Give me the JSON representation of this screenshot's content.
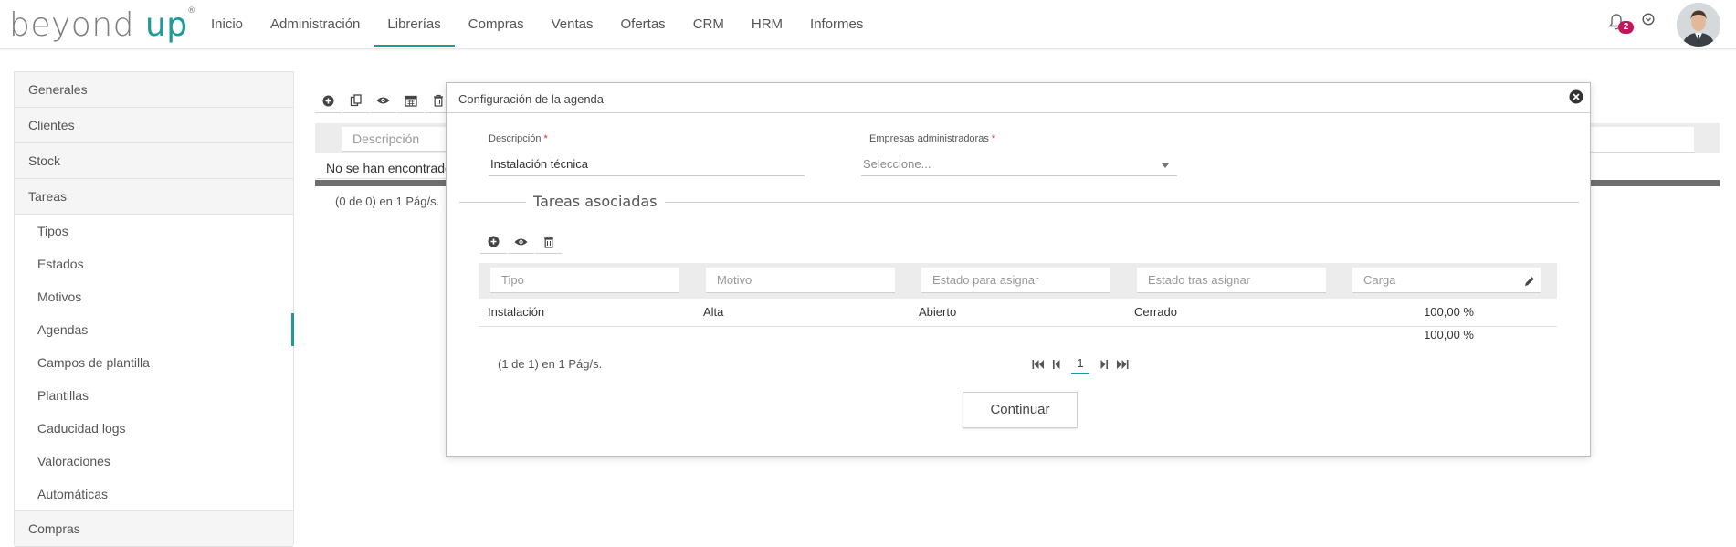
{
  "app": {
    "logo_part1": "beyond",
    "logo_part2": "up",
    "logo_reg": "®"
  },
  "nav": {
    "items": [
      "Inicio",
      "Administración",
      "Librerías",
      "Compras",
      "Ventas",
      "Ofertas",
      "CRM",
      "HRM",
      "Informes"
    ],
    "active_index": 2
  },
  "header_right": {
    "notifications_count": "2",
    "bell_icon": "bell-icon",
    "menu_icon": "chevron-circle-icon"
  },
  "sidebar": {
    "sections": [
      "Generales",
      "Clientes",
      "Stock",
      "Tareas"
    ],
    "subitems": [
      "Tipos",
      "Estados",
      "Motivos",
      "Agendas",
      "Campos de plantilla",
      "Plantillas",
      "Caducidad logs",
      "Valoraciones",
      "Automáticas"
    ],
    "active_subitem": "Agendas",
    "last_section": "Compras"
  },
  "background": {
    "toolbar_icons": [
      "plus-circle-icon",
      "copy-icon",
      "eye-icon",
      "calendar-icon",
      "trash-icon"
    ],
    "desc_placeholder": "Descripción",
    "no_rows": "No se han encontrado",
    "pagination": "(0 de 0) en 1 Pág/s."
  },
  "modal": {
    "title": "Configuración de la agenda",
    "descripcion_label": "Descripción",
    "descripcion_value": "Instalación técnica",
    "empresas_label": "Empresas administradoras",
    "empresas_placeholder": "Seleccione...",
    "required_mark": "*",
    "section_title": "Tareas asociadas",
    "toolbar_icons": [
      "plus-circle-icon",
      "eye-icon",
      "trash-icon"
    ],
    "grid": {
      "filters": [
        "Tipo",
        "Motivo",
        "Estado para asignar",
        "Estado tras asignar",
        "Carga"
      ],
      "rows": [
        {
          "tipo": "Instalación",
          "motivo": "Alta",
          "estado_para": "Abierto",
          "estado_tras": "Cerrado",
          "carga": "100,00 %"
        }
      ],
      "total": "100,00 %"
    },
    "pagination": {
      "text": "(1 de 1) en 1 Pág/s.",
      "current_page": "1"
    },
    "continue_label": "Continuar"
  },
  "colors": {
    "accent": "#1e9a9a",
    "badge": "#c2185b",
    "required": "#d32f2f"
  }
}
